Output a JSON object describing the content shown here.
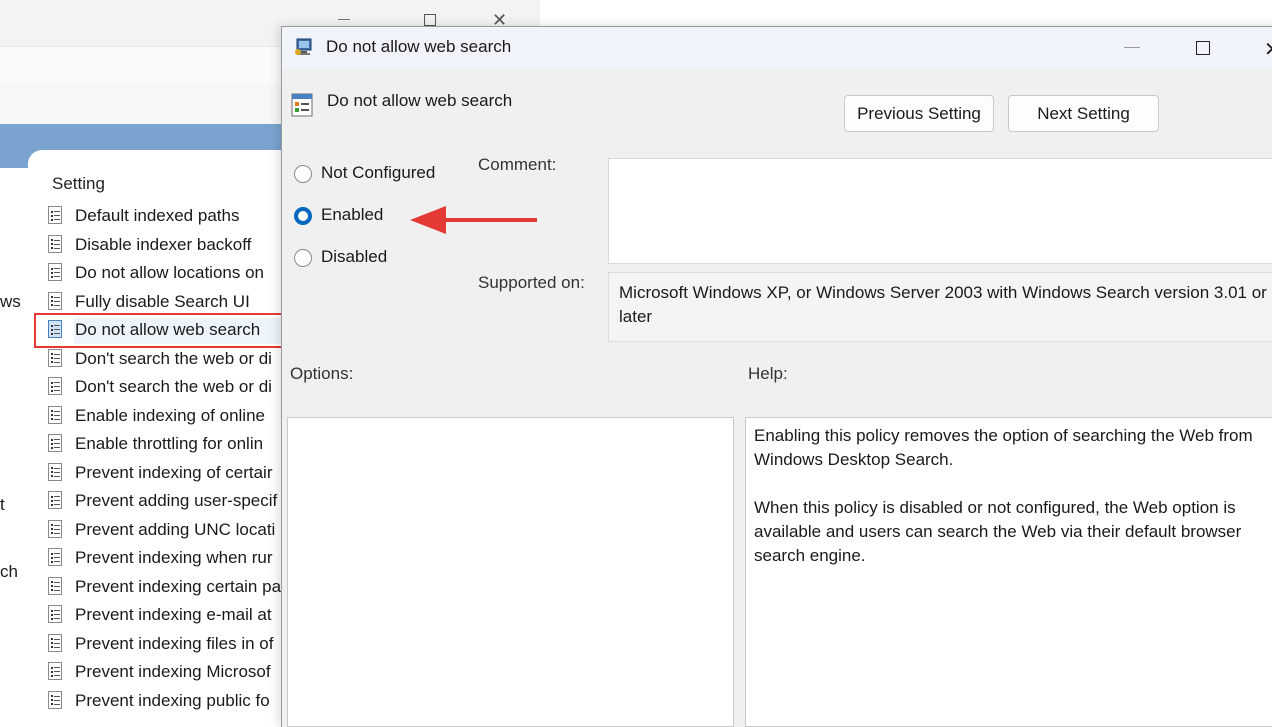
{
  "background_window": {
    "left_pane_fragments": [
      "ws",
      "t",
      "ch"
    ],
    "setting_header": "Setting",
    "items": [
      {
        "label": "Default indexed paths"
      },
      {
        "label": "Disable indexer backoff"
      },
      {
        "label": "Do not allow locations on"
      },
      {
        "label": "Fully disable Search UI"
      },
      {
        "label": "Do not allow web search",
        "selected": true
      },
      {
        "label": "Don't search the web or di"
      },
      {
        "label": "Don't search the web or di"
      },
      {
        "label": "Enable indexing of online"
      },
      {
        "label": "Enable throttling for onlin"
      },
      {
        "label": "Prevent indexing of certair"
      },
      {
        "label": "Prevent adding user-specif"
      },
      {
        "label": "Prevent adding UNC locati"
      },
      {
        "label": "Prevent indexing when rur"
      },
      {
        "label": "Prevent indexing certain pa"
      },
      {
        "label": "Prevent indexing e-mail at"
      },
      {
        "label": "Prevent indexing files in of"
      },
      {
        "label": "Prevent indexing Microsof"
      },
      {
        "label": "Prevent indexing public fo"
      }
    ]
  },
  "dialog": {
    "title": "Do not allow web search",
    "policy_title": "Do not allow web search",
    "prev_button": "Previous Setting",
    "next_button": "Next Setting",
    "radio_options": {
      "not_configured": "Not Configured",
      "enabled": "Enabled",
      "disabled": "Disabled"
    },
    "selected_option": "Enabled",
    "comment_label": "Comment:",
    "comment_value": "",
    "supported_label": "Supported on:",
    "supported_value": "Microsoft Windows XP, or Windows Server 2003 with Windows Search version 3.01 or later",
    "options_label": "Options:",
    "help_label": "Help:",
    "help_paragraphs": [
      "Enabling this policy removes the option of searching the Web from Windows Desktop Search.",
      "When this policy is disabled or not configured, the Web option is available and users can search the Web via their default browser search engine."
    ]
  },
  "colors": {
    "accent": "#0067c0",
    "annotation": "#e53935",
    "header_band": "#7aa4cf"
  }
}
